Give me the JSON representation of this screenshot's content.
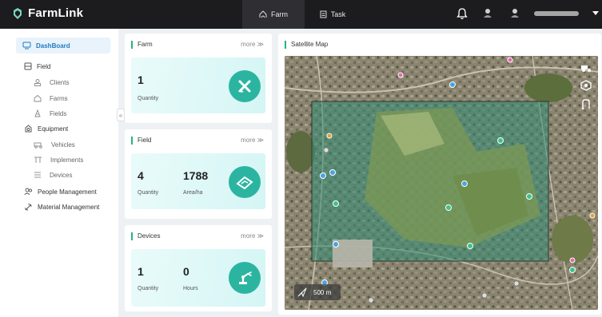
{
  "app": {
    "name": "FarmLink"
  },
  "topbar": {
    "tabs": [
      {
        "label": "Farm",
        "icon": "farm-icon",
        "active": true
      },
      {
        "label": "Task",
        "icon": "task-icon",
        "active": false
      }
    ],
    "icons": [
      "bell-icon",
      "avatar",
      "avatar"
    ]
  },
  "sidebar": {
    "items": [
      {
        "label": "DashBoard",
        "icon": "dashboard-icon",
        "active": true
      },
      {
        "label": "Field",
        "icon": "field-icon"
      },
      {
        "label": "Clients",
        "icon": "clients-icon"
      },
      {
        "label": "Farms",
        "icon": "farms-icon"
      },
      {
        "label": "Fields",
        "icon": "fields-icon"
      },
      {
        "label": "Equipment",
        "icon": "equipment-icon"
      },
      {
        "label": "Vehicles",
        "icon": "vehicles-icon"
      },
      {
        "label": "Implements",
        "icon": "implements-icon"
      },
      {
        "label": "Devices",
        "icon": "devices-icon"
      },
      {
        "label": "People Management",
        "icon": "people-icon"
      },
      {
        "label": "Material Management",
        "icon": "material-icon"
      }
    ],
    "collapse_glyph": "«"
  },
  "cards": {
    "farm": {
      "title": "Farm",
      "more": "more ≫",
      "quantity": "1",
      "quantity_label": "Quantity"
    },
    "field": {
      "title": "Field",
      "more": "more ≫",
      "quantity": "4",
      "quantity_label": "Quantity",
      "area": "1788",
      "area_label": "Area/ha"
    },
    "devices": {
      "title": "Devices",
      "more": "more ≫",
      "quantity": "1",
      "quantity_label": "Quantity",
      "hours": "0",
      "hours_label": "Hours"
    }
  },
  "map": {
    "title": "Satellite Map",
    "scale_label": "500 m"
  },
  "colors": {
    "topbar": "#1c1c1e",
    "accent": "#27b37e",
    "icon_circle": "#2bb5a1",
    "active_nav": "#1f7ac4"
  }
}
